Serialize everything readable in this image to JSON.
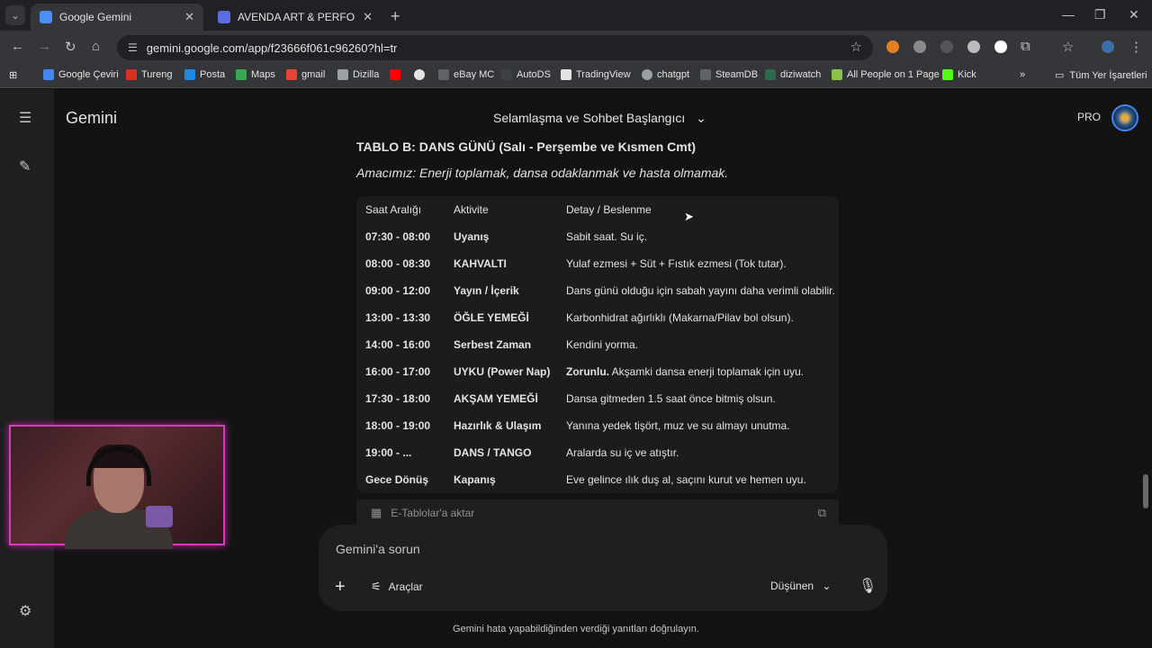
{
  "browser": {
    "tabs": [
      {
        "title": "Google Gemini",
        "active": true,
        "favicon_color": "#4c8df6"
      },
      {
        "title": "AVENDA ART & PERFORMANCE",
        "active": false,
        "favicon_color": "#5b6ee1"
      }
    ],
    "url": "gemini.google.com/app/f23666f061c96260?hl=tr",
    "bookmarks": [
      {
        "label": "Google Çeviri",
        "color": "#4285f4"
      },
      {
        "label": "Tureng",
        "color": "#d93025"
      },
      {
        "label": "Posta",
        "color": "#1e88e5"
      },
      {
        "label": "Maps",
        "color": "#34a853"
      },
      {
        "label": "gmail",
        "color": "#ea4335"
      },
      {
        "label": "Dizilla",
        "color": "#9aa0a6"
      },
      {
        "label": "eBay MC",
        "color": "#5f6368"
      },
      {
        "label": "AutoDS",
        "color": "#3c4043"
      },
      {
        "label": "TradingView",
        "color": "#202124"
      },
      {
        "label": "chatgpt",
        "color": "#9aa0a6"
      },
      {
        "label": "SteamDB",
        "color": "#5f6368"
      },
      {
        "label": "diziwatch",
        "color": "#2d6a4f"
      },
      {
        "label": "All People on 1 Page",
        "color": "#8bc34a"
      },
      {
        "label": "Kick",
        "color": "#53fc18"
      }
    ],
    "all_bookmarks": "Tüm Yer İşaretleri"
  },
  "gemini": {
    "brand": "Gemini",
    "chat_title": "Selamlaşma ve Sohbet Başlangıcı",
    "plan_badge": "PRO",
    "table_heading": "TABLO B: DANS GÜNÜ (Salı - Perşembe ve Kısmen Cmt)",
    "subtitle": "Amacımız: Enerji toplamak, dansa odaklanmak ve hasta olmamak.",
    "columns": [
      "Saat Aralığı",
      "Aktivite",
      "Detay / Beslenme"
    ],
    "rows": [
      [
        "07:30 - 08:00",
        "Uyanış",
        "Sabit saat. Su iç."
      ],
      [
        "08:00 - 08:30",
        "KAHVALTI",
        "Yulaf ezmesi + Süt + Fıstık ezmesi (Tok tutar)."
      ],
      [
        "09:00 - 12:00",
        "Yayın / İçerik",
        "Dans günü olduğu için sabah yayını daha verimli olabilir."
      ],
      [
        "13:00 - 13:30",
        "ÖĞLE YEMEĞİ",
        "Karbonhidrat ağırlıklı (Makarna/Pilav bol olsun)."
      ],
      [
        "14:00 - 16:00",
        "Serbest Zaman",
        "Kendini yorma."
      ],
      [
        "16:00 - 17:00",
        "UYKU (Power Nap)",
        "Zorunlu. Akşamki dansa enerji toplamak için uyu."
      ],
      [
        "17:30 - 18:00",
        "AKŞAM YEMEĞİ",
        "Dansa gitmeden 1.5 saat önce bitmiş olsun."
      ],
      [
        "18:00 - 19:00",
        "Hazırlık & Ulaşım",
        "Yanına yedek tişört, muz ve su almayı unutma."
      ],
      [
        "19:00 - ...",
        "DANS / TANGO",
        "Aralarda su iç ve atıştır."
      ],
      [
        "Gece Dönüş",
        "Kapanış",
        "Eve gelince ılık duş al, saçını kurut ve hemen uyu."
      ]
    ],
    "export_label": "E-Tablolar'a aktar",
    "input_placeholder": "Gemini'a sorun",
    "tools_label": "Araçlar",
    "mode_label": "Düşünen",
    "disclaimer": "Gemini hata yapabildiğinden verdiği yanıtları doğrulayın."
  }
}
